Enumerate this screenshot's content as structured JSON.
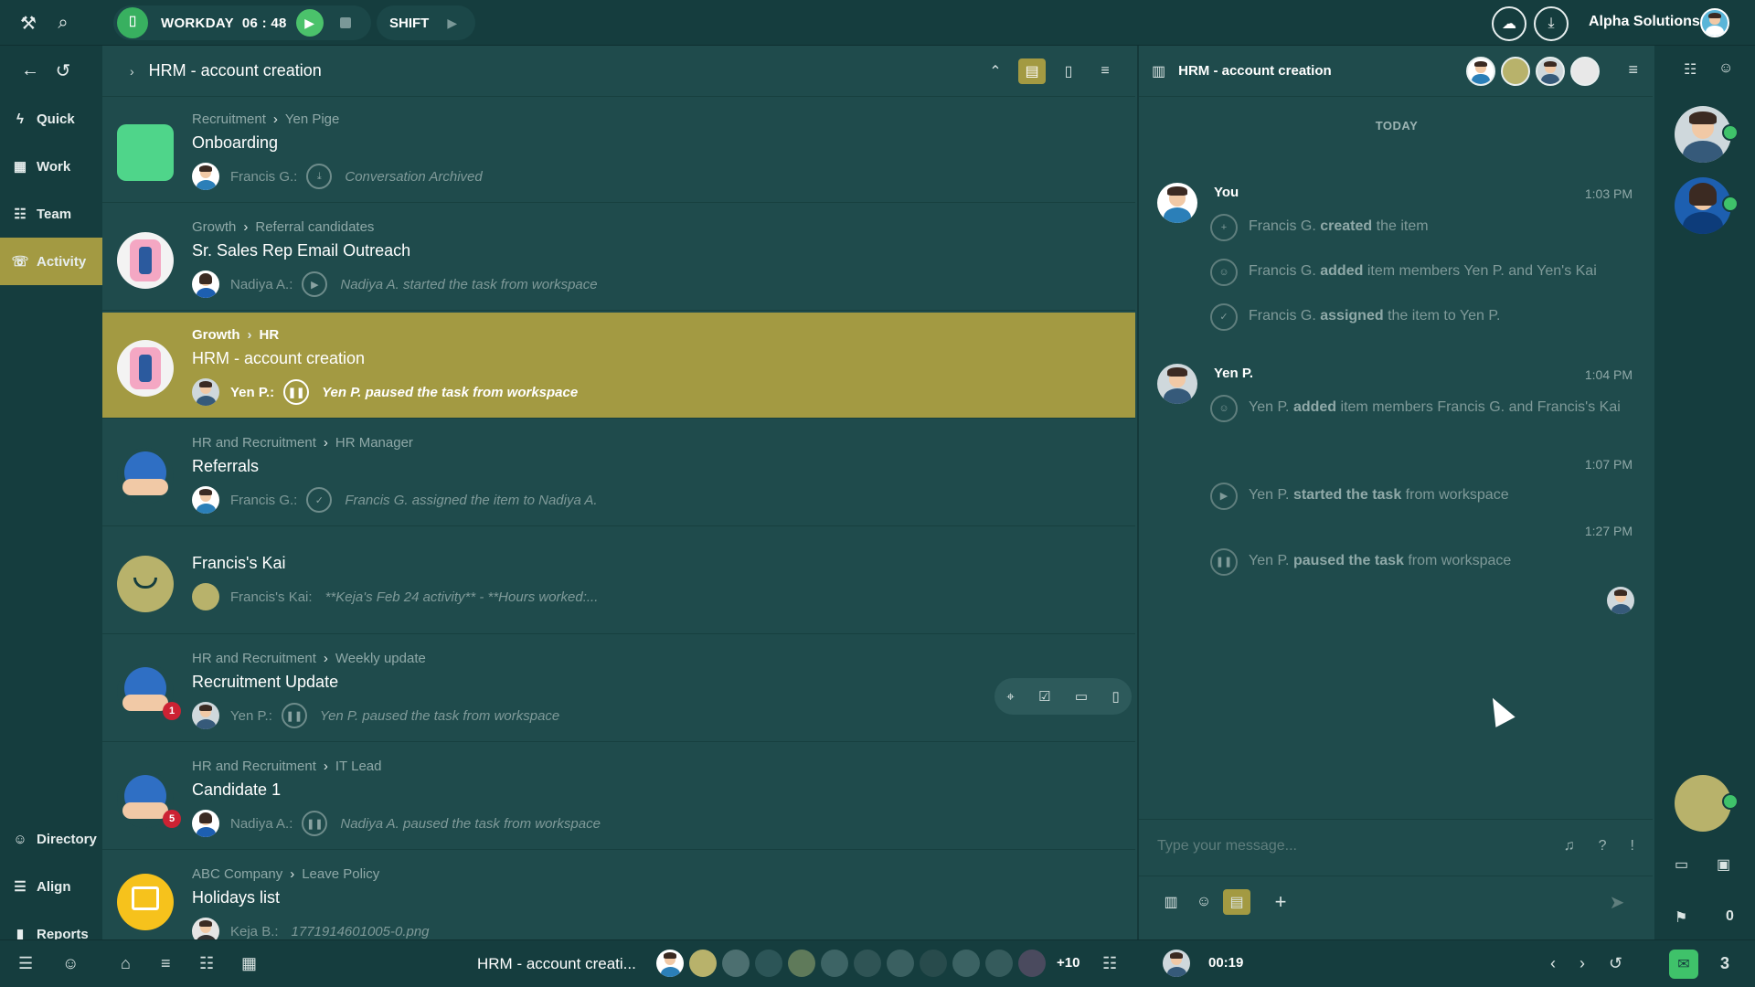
{
  "colors": {
    "accent": "#a39a42",
    "bg": "#1f4b4c",
    "dark": "#153d3e",
    "green": "#3fc26a",
    "badge_red": "#cc2233"
  },
  "topbar": {
    "workday_label": "WORKDAY",
    "workday_time": "06 : 48",
    "shift_label": "SHIFT",
    "org_name": "Alpha Solutions"
  },
  "nav": {
    "quick": "Quick",
    "work": "Work",
    "team": "Team",
    "activity": "Activity",
    "directory": "Directory",
    "align": "Align",
    "reports": "Reports"
  },
  "list": {
    "header_title": "HRM - account creation",
    "items": [
      {
        "crumb_a": "Recruitment",
        "crumb_b": "Yen Pige",
        "name": "Onboarding",
        "who": "Francis G.:",
        "msg": "Conversation Archived"
      },
      {
        "crumb_a": "Growth",
        "crumb_b": "Referral candidates",
        "name": "Sr. Sales Rep Email Outreach",
        "who": "Nadiya A.:",
        "msg": "Nadiya A. started the task from workspace"
      },
      {
        "crumb_a": "Growth",
        "crumb_b": "HR",
        "name": "HRM - account creation",
        "who": "Yen P.:",
        "msg": "Yen P. paused the task from workspace"
      },
      {
        "crumb_a": "HR and Recruitment",
        "crumb_b": "HR Manager",
        "name": "Referrals",
        "who": "Francis G.:",
        "msg": "Francis G. assigned the item to Nadiya A."
      },
      {
        "name": "Francis's Kai",
        "who": "Francis's Kai:",
        "msg": "**Keja's Feb 24 activity** - **Hours worked:..."
      },
      {
        "crumb_a": "HR and Recruitment",
        "crumb_b": "Weekly update",
        "name": "Recruitment Update",
        "who": "Yen P.:",
        "msg": "Yen P. paused the task from workspace",
        "badge": "1"
      },
      {
        "crumb_a": "HR and Recruitment",
        "crumb_b": "IT Lead",
        "name": "Candidate 1",
        "who": "Nadiya A.:",
        "msg": "Nadiya A. paused the task from workspace",
        "badge": "5"
      },
      {
        "crumb_a": "ABC Company",
        "crumb_b": "Leave Policy",
        "name": "Holidays list",
        "who": "Keja B.:",
        "msg": "1771914601005-0.png"
      }
    ]
  },
  "chat": {
    "title": "HRM - account creation",
    "day_label": "TODAY",
    "group1": {
      "author": "You",
      "time": "1:03 PM",
      "ev1": {
        "pre": "Francis G.",
        "bold": "created",
        "post": "the item"
      },
      "ev2": {
        "pre": "Francis G.",
        "bold": "added",
        "post": "item members Yen P. and Yen's Kai"
      },
      "ev3": {
        "pre": "Francis G.",
        "bold": "assigned",
        "post": "the item to Yen P."
      }
    },
    "group2": {
      "author": "Yen P.",
      "time": "1:04 PM",
      "ev1": {
        "pre": "Yen P.",
        "bold": "added",
        "post": "item members Francis G. and Francis's Kai"
      },
      "time2": "1:07 PM",
      "ev2": {
        "pre": "Yen P.",
        "bold": "started the task",
        "post": "from workspace"
      },
      "time3": "1:27 PM",
      "ev3": {
        "pre": "Yen P.",
        "bold": "paused the task",
        "post": "from workspace"
      }
    },
    "input_placeholder": "Type your message..."
  },
  "rail": {
    "flag_count": "0"
  },
  "bottombar": {
    "title": "HRM - account creati...",
    "more_members": "+10",
    "timer": "00:19",
    "chat_count": "3"
  }
}
